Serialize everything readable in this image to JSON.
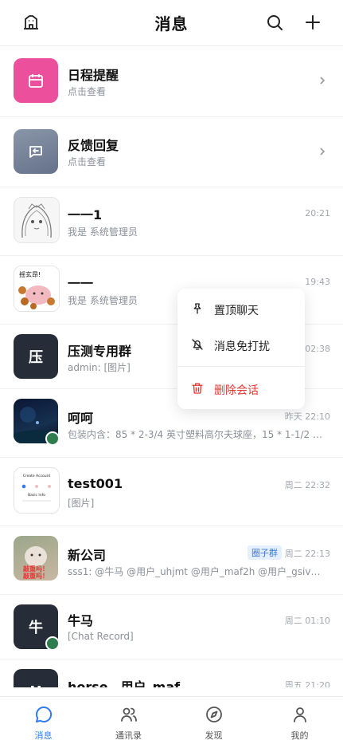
{
  "header": {
    "title": "消息",
    "left_icon": "building-icon",
    "right_icons": [
      "search-icon",
      "plus-icon"
    ]
  },
  "conversations": [
    {
      "name": "日程提醒",
      "subtitle": "点击查看",
      "icon": "calendar-icon",
      "color": "#ec4f9c"
    },
    {
      "name": "反馈回复",
      "subtitle": "点击查看",
      "icon": "reply-icon",
      "color": "#6f7b8f"
    },
    {
      "name": "一一1",
      "subtitle": "我是 系统管理员",
      "time": "20:21",
      "avatar": "anime-girl-sketch"
    },
    {
      "name": "一一",
      "subtitle": "我是 系统管理员",
      "time": "19:43",
      "avatar": "sticker-image",
      "avatar_text": "摇玄昂!"
    },
    {
      "name": "压测专用群",
      "subtitle": "admin: [图片]",
      "time": "02:38",
      "avatar_letter": "压"
    },
    {
      "name": "呵呵",
      "subtitle": "包装内含：85 * 2-3/4 英寸塑料高尔夫球座，15 * 1-1/2 英...",
      "time": "昨天 22:10",
      "avatar": "night-photo"
    },
    {
      "name": "test001",
      "subtitle": "[图片]",
      "time": "周二 22:32",
      "avatar": "screenshot-image",
      "avatar_text_1": "Create Account",
      "avatar_text_2": "Basic Info"
    },
    {
      "name": "新公司",
      "subtitle": "sss1: @牛马 @用户_uhjmt @用户_maf2h @用户_gsiv5 @...",
      "time": "周二 22:13",
      "tag": "圈子群",
      "avatar": "cat-photo",
      "avatar_text_1": "敲重吗！",
      "avatar_text_2": "敲重吗！"
    },
    {
      "name": "牛马",
      "subtitle": "[Chat Record]",
      "time": "周二 01:10",
      "avatar_letter": "牛"
    },
    {
      "name": "horse，用户_maf",
      "subtitle": "",
      "time": "周五 21:20",
      "avatar_letter": "H"
    }
  ],
  "context_menu": {
    "items": [
      {
        "label": "置顶聊天",
        "icon": "pin-icon",
        "color": "#222222"
      },
      {
        "label": "消息免打扰",
        "icon": "bell-off-icon",
        "color": "#222222"
      },
      {
        "label": "删除会话",
        "icon": "trash-icon",
        "color": "#e53935"
      }
    ]
  },
  "tabbar": {
    "tabs": [
      {
        "label": "消息",
        "icon": "chat-bubble-icon",
        "active": true
      },
      {
        "label": "通讯录",
        "icon": "contacts-icon",
        "active": false
      },
      {
        "label": "发现",
        "icon": "compass-icon",
        "active": false
      },
      {
        "label": "我的",
        "icon": "person-icon",
        "active": false
      }
    ],
    "active_color": "#2f7bf6"
  }
}
